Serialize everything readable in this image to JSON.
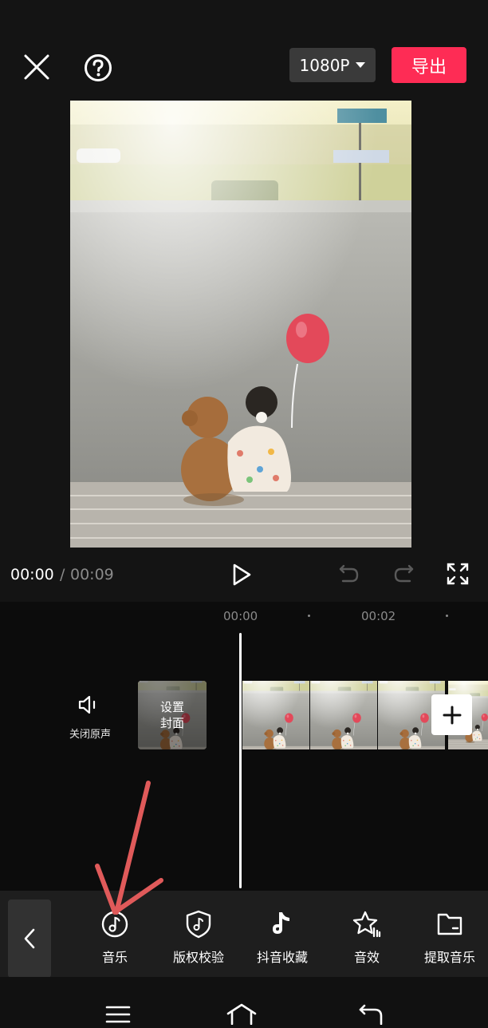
{
  "header": {
    "resolution_label": "1080P",
    "export_label": "导出"
  },
  "playback": {
    "current_time": "00:00",
    "separator": "/",
    "total_time": "00:09"
  },
  "timeline": {
    "ticks": [
      "00:00",
      "00:02"
    ],
    "mute_label": "关闭原声",
    "cover_label_line1": "设置",
    "cover_label_line2": "封面"
  },
  "toolbar": {
    "items": [
      {
        "label": "音乐",
        "icon": "music-note-icon"
      },
      {
        "label": "版权校验",
        "icon": "shield-music-icon"
      },
      {
        "label": "抖音收藏",
        "icon": "douyin-icon"
      },
      {
        "label": "音效",
        "icon": "star-sound-icon"
      },
      {
        "label": "提取音乐",
        "icon": "folder-icon"
      }
    ]
  },
  "colors": {
    "accent": "#fe2c55",
    "background": "#111111",
    "toolbar_bg": "#1e1e1e",
    "annotation_arrow": "#e05a5a"
  }
}
